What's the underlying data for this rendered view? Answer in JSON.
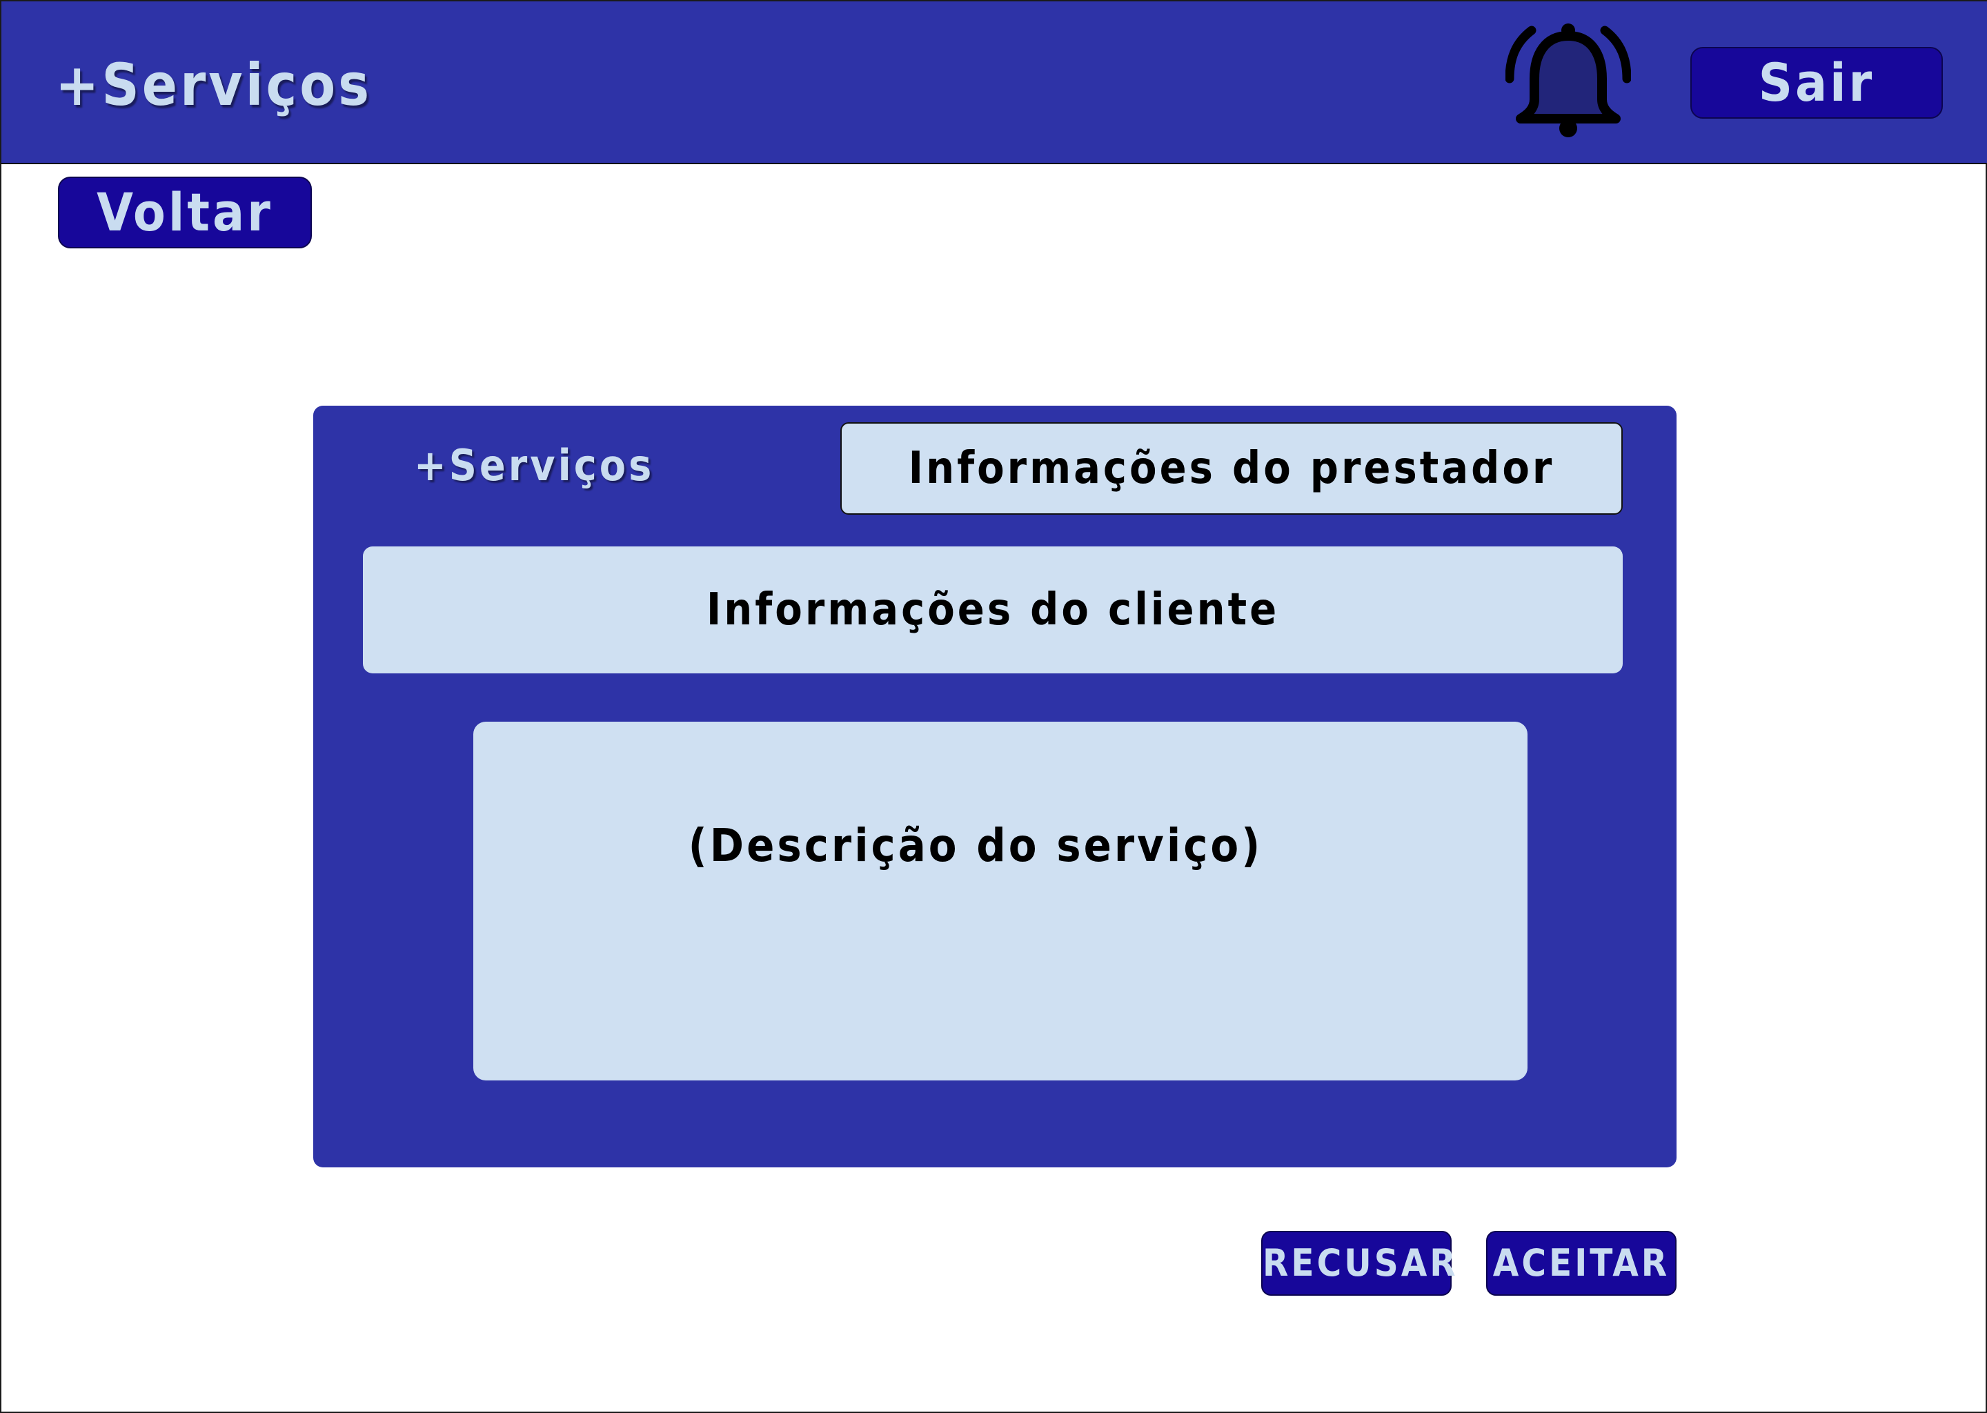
{
  "header": {
    "brand": "+Serviços",
    "exit_label": "Sair"
  },
  "nav": {
    "back_label": "Voltar"
  },
  "card": {
    "brand": "+Serviços",
    "provider_tab_label": "Informações do prestador",
    "client_info_label": "Informações do cliente",
    "description_placeholder": "(Descrição do serviço)"
  },
  "actions": {
    "reject_label": "RECUSAR",
    "accept_label": "ACEITAR"
  },
  "icons": {
    "notification": "bell-icon"
  },
  "colors": {
    "primary": "#2e33a7",
    "button": "#17079a",
    "panel": "#cfe0f2",
    "text_light": "#c9dcf0",
    "bell_fill": "#22257a"
  }
}
